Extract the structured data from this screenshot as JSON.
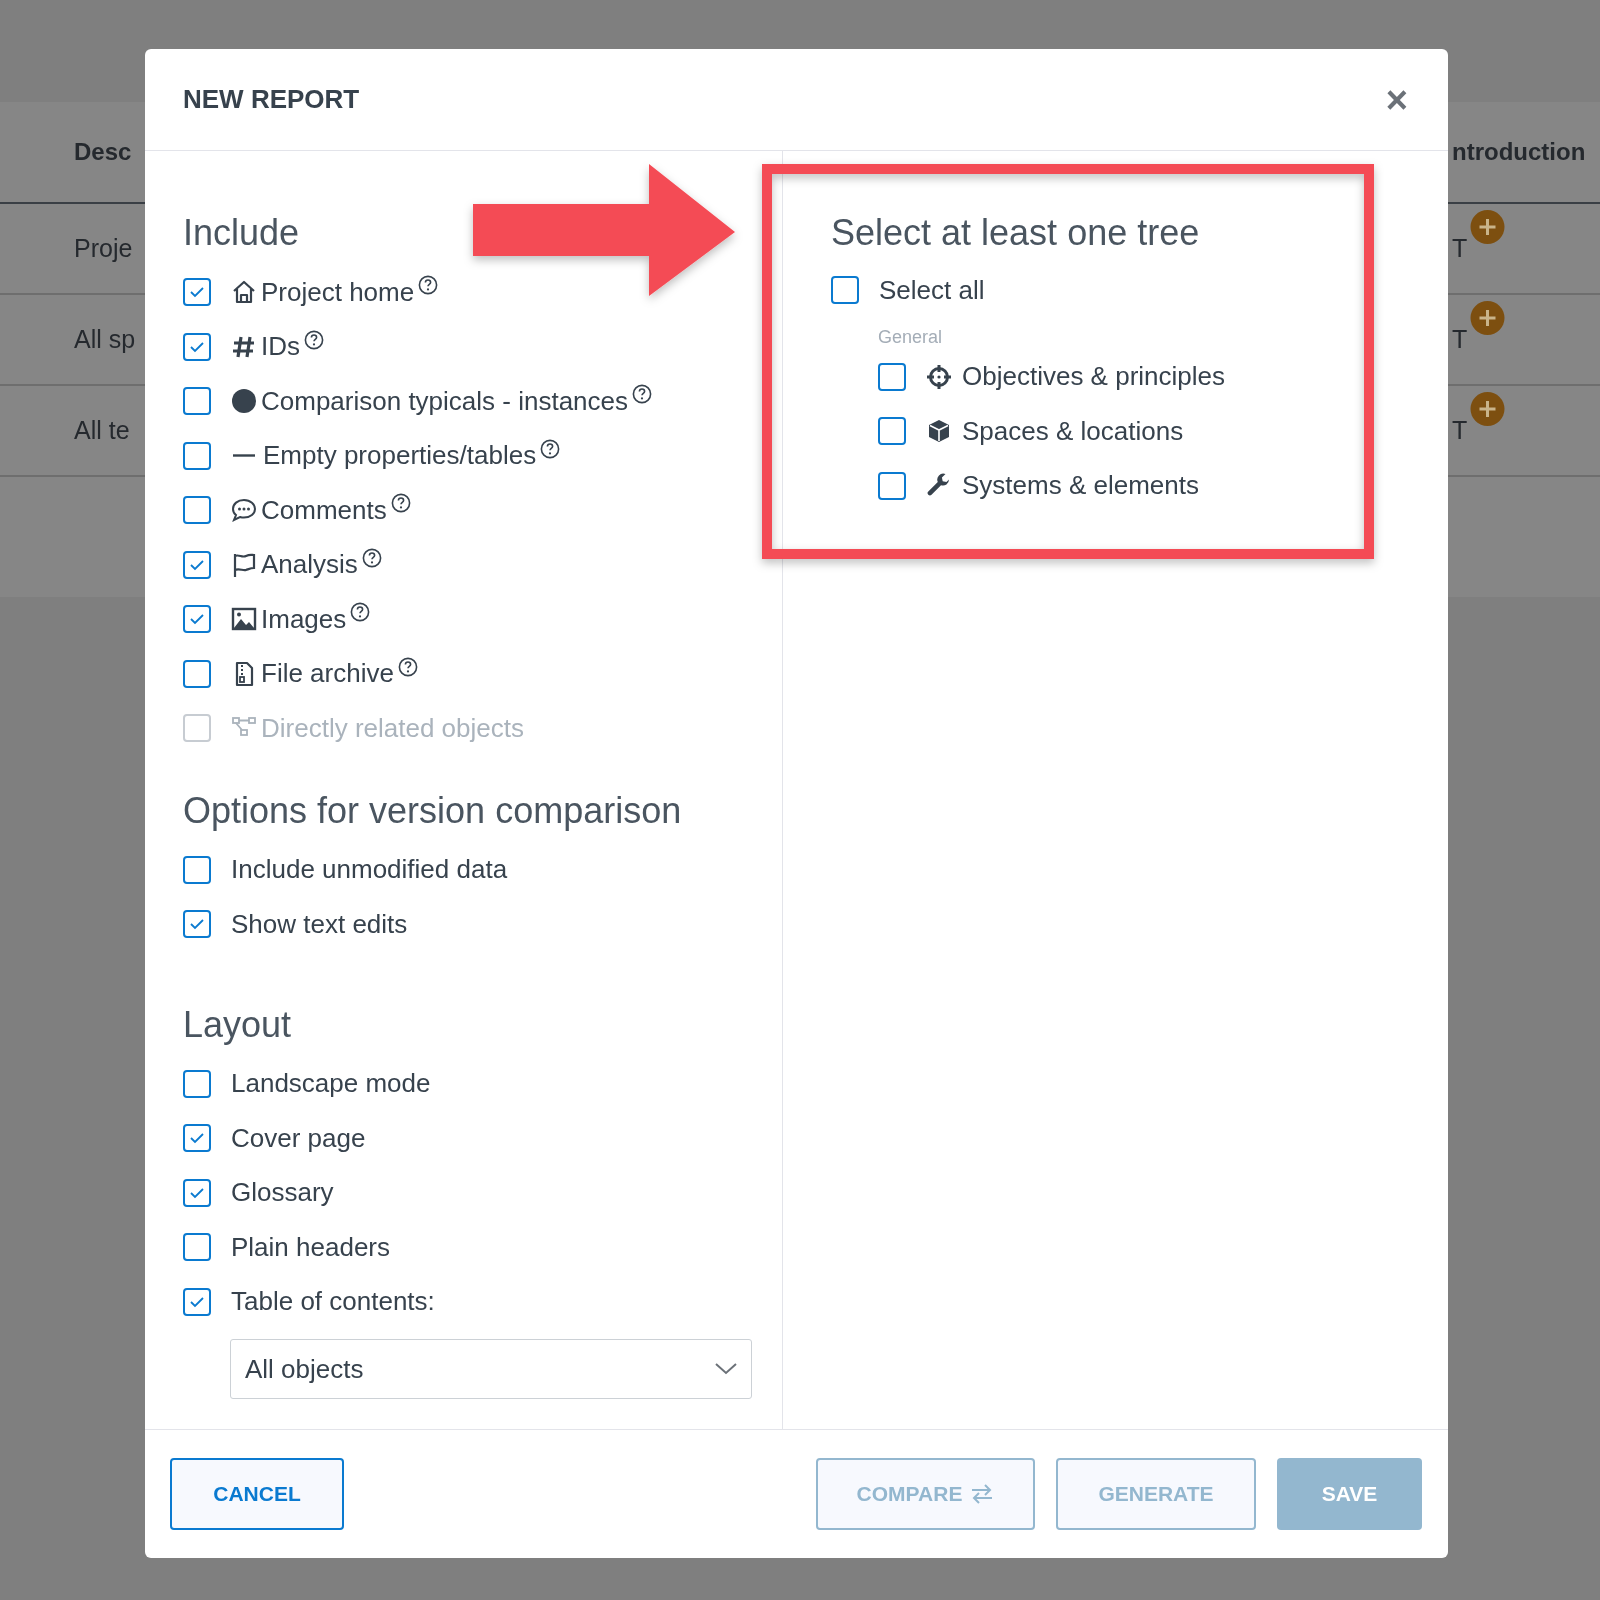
{
  "background_table": {
    "columns": [
      "Desc",
      "ntroduction"
    ],
    "rows": [
      {
        "cells": [
          "Proje",
          "T"
        ]
      },
      {
        "cells": [
          "All sp",
          "T"
        ]
      },
      {
        "cells": [
          "All te",
          "T"
        ]
      }
    ]
  },
  "dialog": {
    "title": "NEW REPORT",
    "close": "×",
    "include": {
      "heading": "Include",
      "options": [
        {
          "label": "Project home",
          "checked": true,
          "disabled": false,
          "help": true
        },
        {
          "label": "IDs",
          "checked": true,
          "disabled": false,
          "help": true
        },
        {
          "label": "Comparison typicals - instances",
          "checked": false,
          "disabled": false,
          "help": true
        },
        {
          "label": "Empty properties/tables",
          "checked": false,
          "disabled": false,
          "help": true
        },
        {
          "label": "Comments",
          "checked": false,
          "disabled": false,
          "help": true
        },
        {
          "label": "Analysis",
          "checked": true,
          "disabled": false,
          "help": true
        },
        {
          "label": "Images",
          "checked": true,
          "disabled": false,
          "help": true
        },
        {
          "label": "File archive",
          "checked": false,
          "disabled": false,
          "help": true
        },
        {
          "label": "Directly related objects",
          "checked": false,
          "disabled": true,
          "help": false
        }
      ]
    },
    "version_options": {
      "heading": "Options for version comparison",
      "options": [
        {
          "label": "Include unmodified data",
          "checked": false
        },
        {
          "label": "Show text edits",
          "checked": true
        }
      ]
    },
    "layout": {
      "heading": "Layout",
      "options": [
        {
          "label": "Landscape mode",
          "checked": false
        },
        {
          "label": "Cover page",
          "checked": true
        },
        {
          "label": "Glossary",
          "checked": true
        },
        {
          "label": "Plain headers",
          "checked": false
        },
        {
          "label": "Table of contents:",
          "checked": true
        }
      ],
      "toc_select": {
        "value": "All objects"
      }
    },
    "trees": {
      "heading": "Select at least one tree",
      "select_all": {
        "label": "Select all",
        "checked": false
      },
      "group": "General",
      "items": [
        {
          "label": "Objectives & principles",
          "checked": false
        },
        {
          "label": "Spaces & locations",
          "checked": false
        },
        {
          "label": "Systems & elements",
          "checked": false
        }
      ]
    },
    "buttons": [
      {
        "label": "CANCEL",
        "kind": "outline",
        "disabled": false
      },
      {
        "label": "COMPARE",
        "kind": "compare",
        "disabled": true
      },
      {
        "label": "GENERATE",
        "kind": "outline",
        "disabled": true
      },
      {
        "label": "SAVE",
        "kind": "primary",
        "disabled": true
      }
    ]
  }
}
